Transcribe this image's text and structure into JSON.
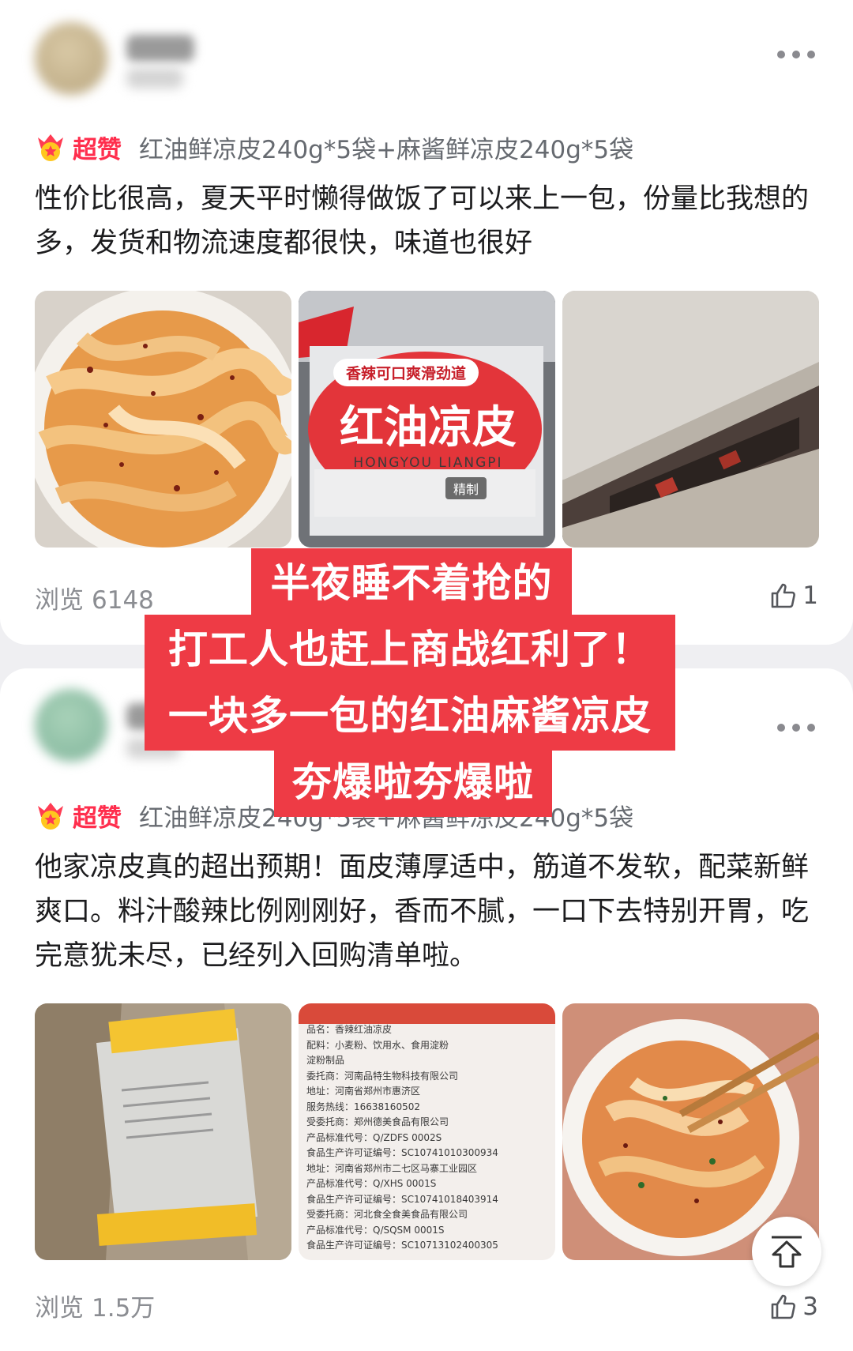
{
  "posts": [
    {
      "badge": "超赞",
      "spec": "红油鲜凉皮240g*5袋+麻酱鲜凉皮240g*5袋",
      "review": "性价比很高，夏天平时懒得做饭了可以来上一包，份量比我想的多，发货和物流速度都很快，味道也很好",
      "photos": [
        {
          "kind": "noodle-bowl-photo"
        },
        {
          "kind": "package-photo",
          "pkg_tag": "香辣可口爽滑劲道",
          "pkg_title": "红油凉皮",
          "pkg_pinyin": "HONGYOU LIANGPI",
          "pkg_refined": "精制"
        },
        {
          "kind": "shipping-box-photo"
        }
      ],
      "views_label": "浏览",
      "views_count": "6148",
      "likes": "1"
    },
    {
      "badge": "超赞",
      "spec": "红油鲜凉皮240g*5袋+麻酱鲜凉皮240g*5袋",
      "review": "他家凉皮真的超出预期！面皮薄厚适中，筋道不发软，配菜新鲜爽口。料汁酸辣比例刚刚好，香而不腻，一口下去特别开胃，吃完意犹未尽，已经列入回购清单啦。",
      "photos": [
        {
          "kind": "opened-box-photo"
        },
        {
          "kind": "label-photo",
          "label_lines": [
            "品名：香辣红油凉皮",
            "配料：小麦粉、饮用水、食用淀粉",
            "淀粉制品",
            "委托商：河南品特生物科技有限公司",
            "地址：河南省郑州市惠济区",
            "服务热线：16638160502",
            "受委托商：郑州德美食品有限公司",
            "产品标准代号：Q/ZDFS 0002S",
            "食品生产许可证编号：SC10741010300934",
            "地址：河南省郑州市二七区马寨工业园区",
            "产品标准代号：Q/XHS 0001S",
            "食品生产许可证编号：SC10741018403914",
            "受委托商：河北食全食美食品有限公司",
            "产品标准代号：Q/SQSM 0001S",
            "食品生产许可证编号：SC10713102400305"
          ]
        },
        {
          "kind": "noodle-chopsticks-photo"
        }
      ],
      "views_label": "浏览",
      "views_count": "1.5万",
      "likes": "3"
    }
  ],
  "overlay": {
    "lines": [
      "半夜睡不着抢的",
      "打工人也赶上商战红利了！",
      "一块多一包的红油麻酱凉皮",
      "夯爆啦夯爆啦"
    ]
  },
  "colors": {
    "badge_red": "#ff2e4d",
    "banner_red": "#ee3b45",
    "page_bg": "#efeff2"
  }
}
